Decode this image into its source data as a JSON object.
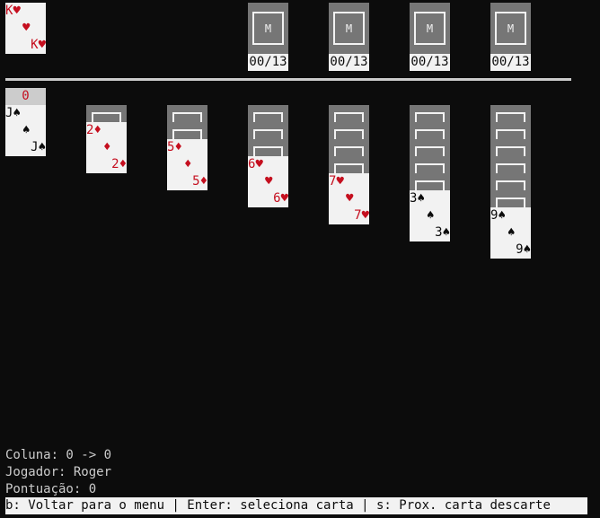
{
  "colors": {
    "background": "#0c0c0c",
    "card_face": "#f2f2f2",
    "card_back": "#767676",
    "red_suit": "#c50f1f",
    "black_suit": "#0c0c0c",
    "text": "#cccccc"
  },
  "discard": {
    "rank": "K",
    "suit": "♥",
    "color": "red"
  },
  "foundations": [
    {
      "label": "M",
      "count": "00/13"
    },
    {
      "label": "M",
      "count": "00/13"
    },
    {
      "label": "M",
      "count": "00/13"
    },
    {
      "label": "M",
      "count": "00/13"
    }
  ],
  "selection_marker": "0",
  "tableau": [
    {
      "hidden": 0,
      "rank": "J",
      "suit": "♠",
      "color": "black"
    },
    {
      "hidden": 1,
      "rank": "2",
      "suit": "♦",
      "color": "red"
    },
    {
      "hidden": 2,
      "rank": "5",
      "suit": "♦",
      "color": "red"
    },
    {
      "hidden": 3,
      "rank": "6",
      "suit": "♥",
      "color": "red"
    },
    {
      "hidden": 4,
      "rank": "7",
      "suit": "♥",
      "color": "red"
    },
    {
      "hidden": 5,
      "rank": "3",
      "suit": "♠",
      "color": "black"
    },
    {
      "hidden": 6,
      "rank": "9",
      "suit": "♠",
      "color": "black"
    }
  ],
  "status": {
    "column": "Coluna: 0 -> 0",
    "player": "Jogador: Roger",
    "score": "Pontuação: 0"
  },
  "help_bar": "b: Voltar para o menu | Enter: seleciona carta | s: Prox. carta descarte"
}
